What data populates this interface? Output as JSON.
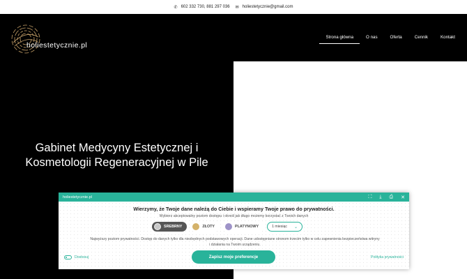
{
  "topbar": {
    "phone_icon": "phone-icon",
    "phone": "602 332 730, 881 297 036",
    "mail_icon": "mail-icon",
    "email": "holiestetycznie@gmail.com"
  },
  "logo": {
    "text": "holiestetycznie.pl"
  },
  "menu": {
    "items": [
      {
        "label": "Strona główna"
      },
      {
        "label": "O nas"
      },
      {
        "label": "Oferta"
      },
      {
        "label": "Cennik"
      },
      {
        "label": "Kontakt"
      }
    ]
  },
  "hero": {
    "title_line1": "Gabinet Medycyny Estetycznej i",
    "title_line2": "Kosmetologii Regeneracyjnej w Pile"
  },
  "cookie": {
    "site": "holiestetycznie.pl",
    "title": "Wierzymy, że Twoje dane należą do Ciebie i wspieramy Twoje prawo do prywatności.",
    "subtitle": "Wybierz akceptowalny poziom dostępu i określ jak długo możemy korzystać z Twoich danych",
    "levels": [
      {
        "label": "SREBRNY",
        "color": "#c8c8c8"
      },
      {
        "label": "ZŁOTY",
        "color": "#d4b26a"
      },
      {
        "label": "PLATYNOWY",
        "color": "#9e93c8"
      }
    ],
    "period": "1 miesiąc",
    "description_line1": "Najwyższy poziom prywatności. Dostęp do danych tylko dla niezbędnych podstawowych operacji. Dane udostępniane stronom trzecim tylko w celu zapewnienia bezpieczeństwa witryny",
    "description_line2": "i działania na Twoim urządzeniu.",
    "customize": "Dostosuj",
    "save": "Zapisz moje preferencje",
    "policy": "Polityka prywatności",
    "accent": "#29b39a"
  }
}
